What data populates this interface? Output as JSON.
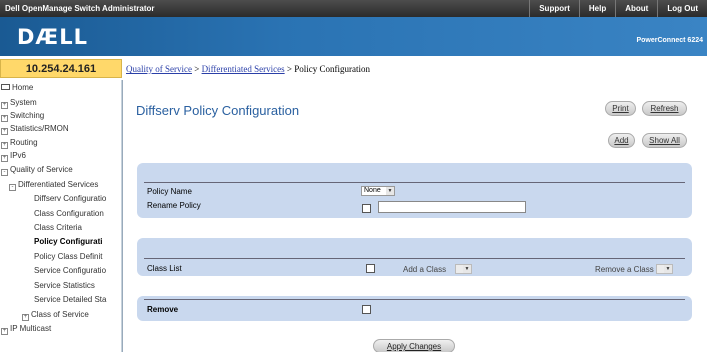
{
  "topbar": {
    "app_title": "Dell OpenManage Switch Administrator",
    "links": [
      "Support",
      "Help",
      "About",
      "Log Out"
    ]
  },
  "banner": {
    "logo": "DÆLL",
    "model": "PowerConnect 6224"
  },
  "ip_address": "10.254.24.161",
  "breadcrumb": {
    "items": [
      "Quality of Service",
      "Differentiated Services"
    ],
    "current": "Policy Configuration",
    "sep": ">"
  },
  "sidebar": {
    "items": [
      {
        "label": "Home",
        "icon": "home-icon"
      },
      {
        "label": "System",
        "exp": "+"
      },
      {
        "label": "Switching",
        "exp": "+"
      },
      {
        "label": "Statistics/RMON",
        "exp": "+"
      },
      {
        "label": "Routing",
        "exp": "+"
      },
      {
        "label": "IPv6",
        "exp": "+"
      },
      {
        "label": "Quality of Service",
        "exp": "-"
      },
      {
        "label": "Differentiated Services",
        "exp": "-"
      },
      {
        "label": "Diffserv Configuratio"
      },
      {
        "label": "Class Configuration"
      },
      {
        "label": "Class Criteria"
      },
      {
        "label": "Policy Configurati"
      },
      {
        "label": "Policy Class Definit"
      },
      {
        "label": "Service Configuratio"
      },
      {
        "label": "Service Statistics"
      },
      {
        "label": "Service Detailed Sta"
      },
      {
        "label": "Class of Service",
        "exp": "+"
      },
      {
        "label": "IP Multicast",
        "exp": "+"
      }
    ]
  },
  "page": {
    "title": "Diffserv Policy Configuration",
    "buttons": {
      "print": "Print",
      "refresh": "Refresh",
      "add": "Add",
      "show_all": "Show All"
    }
  },
  "form": {
    "policy_name_label": "Policy Name",
    "policy_name_value": "None",
    "rename_policy_label": "Rename Policy",
    "rename_policy_value": "",
    "class_list_label": "Class List",
    "add_class_label": "Add a Class",
    "remove_class_label": "Remove a Class",
    "remove_label": "Remove",
    "apply_label": "Apply Changes"
  },
  "colors": {
    "title": "#2a60a0",
    "panel": "#c9d8ee",
    "ip_box": "#ffd86a",
    "banner": "#2a73b3"
  }
}
